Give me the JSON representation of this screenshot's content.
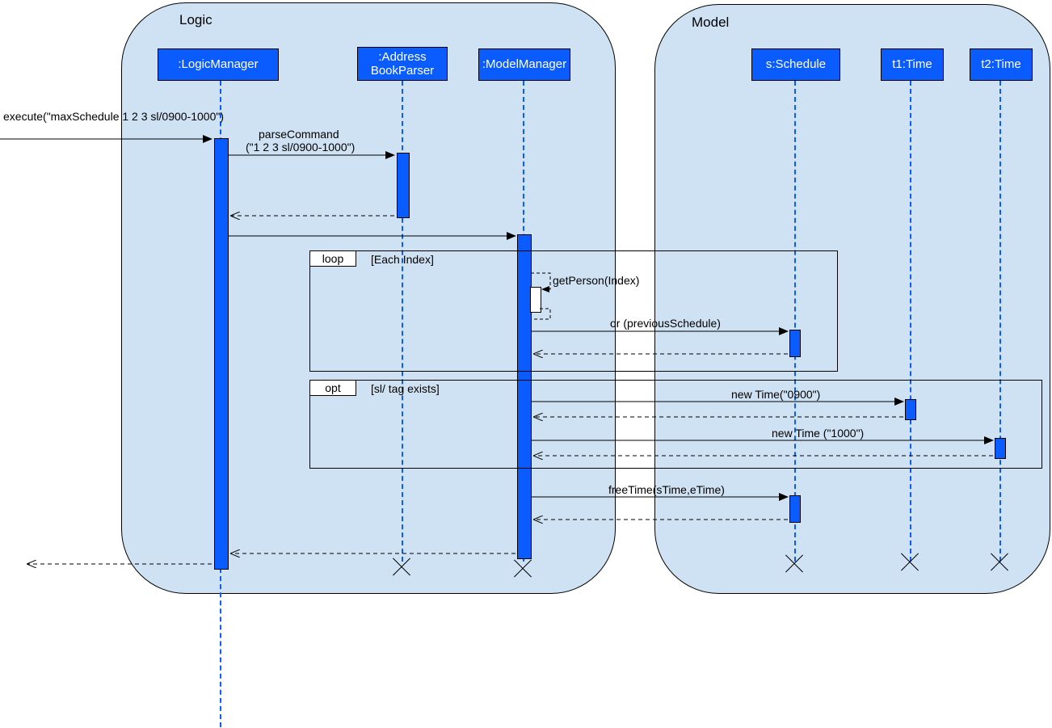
{
  "containers": {
    "logic": "Logic",
    "model": "Model"
  },
  "lifelines": {
    "lm": ":LogicManager",
    "abp": ":Address\nBookParser",
    "mm": ":ModelManager",
    "sched": "s:Schedule",
    "t1": "t1:Time",
    "t2": "t2:Time"
  },
  "messages": {
    "execute": "execute(\"maxSchedule 1 2 3 sl/0900-1000\")",
    "parse1": "parseCommand",
    "parse2": "(\"1 2 3 sl/0900-1000\")",
    "getPerson": "getPerson(Index)",
    "orPrev": "or (previousSchedule)",
    "newTime0900": "new Time(\"0900\")",
    "newTime1000": "new Time (\"1000\")",
    "freeTime": "freeTime(sTime,eTime)"
  },
  "fragments": {
    "loop": {
      "label": "loop",
      "cond": "[Each Index]"
    },
    "opt": {
      "label": "opt",
      "cond": "[sl/ tag exists]"
    }
  }
}
